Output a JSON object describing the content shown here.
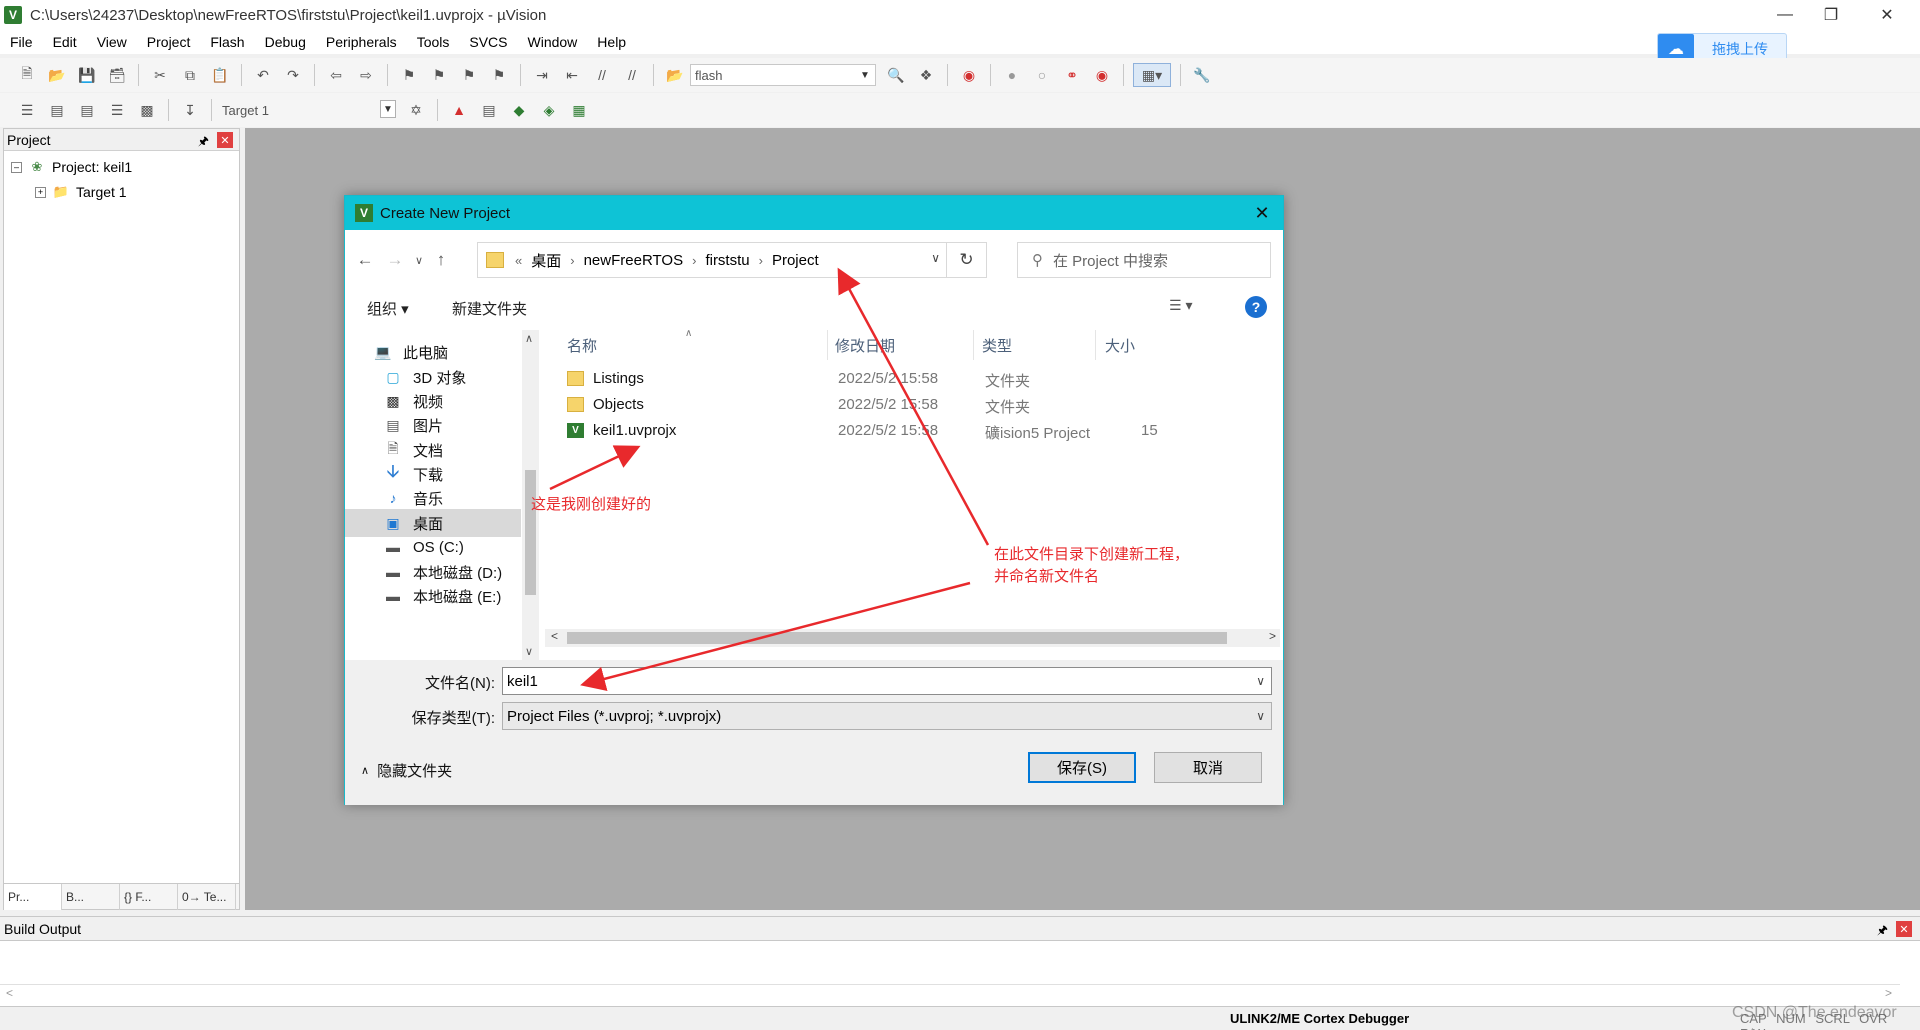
{
  "window": {
    "title": "C:\\Users\\24237\\Desktop\\newFreeRTOS\\firststu\\Project\\keil1.uvprojx - µVision",
    "app_icon_glyph": "V"
  },
  "menu": [
    "File",
    "Edit",
    "View",
    "Project",
    "Flash",
    "Debug",
    "Peripherals",
    "Tools",
    "SVCS",
    "Window",
    "Help"
  ],
  "upload_button": {
    "label": "拖拽上传",
    "icon": "cloud-icon",
    "color": "#2f8cf0"
  },
  "toolbar1": {
    "target_combo": "flash"
  },
  "toolbar2": {
    "target_select": "Target 1"
  },
  "project_panel": {
    "title": "Project",
    "tree": [
      {
        "label": "Project: keil1",
        "expanded": true
      },
      {
        "label": "Target 1",
        "expanded": false
      }
    ],
    "tabs": [
      "Pr...",
      "B...",
      "{} F...",
      "0→ Te..."
    ]
  },
  "build_output": {
    "title": "Build Output"
  },
  "statusbar": {
    "debugger": "ULINK2/ME Cortex Debugger",
    "keys": "CAP NUM SCRL OVR R/W"
  },
  "watermark": "CSDN @The endeavor",
  "dialog": {
    "title": "Create New Project",
    "icon_glyph": "V",
    "breadcrumb": [
      "桌面",
      "newFreeRTOS",
      "firststu",
      "Project"
    ],
    "breadcrumb_prefix": "«",
    "search_placeholder": "在 Project 中搜索",
    "commands": {
      "organize": "组织 ▾",
      "new_folder": "新建文件夹"
    },
    "nav_items": [
      {
        "label": "此电脑",
        "icon": "computer-icon"
      },
      {
        "label": "3D 对象",
        "icon": "cube-icon"
      },
      {
        "label": "视频",
        "icon": "video-icon"
      },
      {
        "label": "图片",
        "icon": "picture-icon"
      },
      {
        "label": "文档",
        "icon": "document-icon"
      },
      {
        "label": "下载",
        "icon": "download-icon"
      },
      {
        "label": "音乐",
        "icon": "music-icon"
      },
      {
        "label": "桌面",
        "icon": "desktop-icon",
        "selected": true
      },
      {
        "label": "OS (C:)",
        "icon": "drive-icon"
      },
      {
        "label": "本地磁盘 (D:)",
        "icon": "drive-icon"
      },
      {
        "label": "本地磁盘 (E:)",
        "icon": "drive-icon"
      }
    ],
    "columns": {
      "name": "名称",
      "date": "修改日期",
      "type": "类型",
      "size": "大小"
    },
    "files": [
      {
        "name": "Listings",
        "date": "2022/5/2 15:58",
        "type": "文件夹",
        "size": "",
        "kind": "folder"
      },
      {
        "name": "Objects",
        "date": "2022/5/2 15:58",
        "type": "文件夹",
        "size": "",
        "kind": "folder"
      },
      {
        "name": "keil1.uvprojx",
        "date": "2022/5/2 15:58",
        "type": "礦ision5 Project",
        "size": "15",
        "kind": "project"
      }
    ],
    "filename_label": "文件名(N):",
    "filename_value": "keil1",
    "filetype_label": "保存类型(T):",
    "filetype_value": "Project Files (*.uvproj; *.uvprojx)",
    "hide_folders": "隐藏文件夹",
    "save_button": "保存(S)",
    "cancel_button": "取消"
  },
  "annotations": {
    "created": "这是我刚创建好的",
    "instruction_line1": "在此文件目录下创建新工程，",
    "instruction_line2": "并命名新文件名",
    "color": "#e8292c"
  }
}
